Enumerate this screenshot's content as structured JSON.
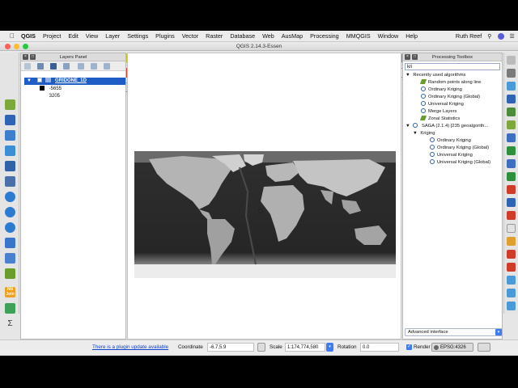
{
  "menubar": {
    "app_name": "QGIS",
    "items": [
      "Project",
      "Edit",
      "View",
      "Layer",
      "Settings",
      "Plugins",
      "Vector",
      "Raster",
      "Database",
      "Web",
      "AusMap",
      "Processing",
      "MMQGIS",
      "Window",
      "Help"
    ],
    "user": "Ruth Reef"
  },
  "window": {
    "title": "QGIS 2.14.3-Essen"
  },
  "layers_panel": {
    "title": "Layers Panel",
    "layer_name": "GRIDONE_1D",
    "legend_min": "-5655",
    "legend_max": "3205"
  },
  "processing": {
    "title": "Processing Toolbox",
    "search_value": "kri",
    "recent_group": "Recently used algorithms",
    "recent_items": [
      "Random points along line",
      "Ordinary Kriging",
      "Ordinary Kriging (Global)",
      "Universal Kriging",
      "Merge Layers",
      "Zonal Statistics"
    ],
    "saga_group": "SAGA (2.1.4) [235 geoalgorith...",
    "kriging_group": "Kriging",
    "kriging_items": [
      "Ordinary Kriging",
      "Ordinary Kriging (Global)",
      "Universal Kriging",
      "Universal Kriging (Global)"
    ],
    "interface_label": "Advanced interface"
  },
  "statusbar": {
    "plugin_update": "There is a plugin update available",
    "coordinate_label": "Coordinate",
    "coordinate_value": "-6.7,5.9",
    "scale_label": "Scale",
    "scale_value": "1:174,774,580",
    "rotation_label": "Rotation",
    "rotation_value": "0.0",
    "render_label": "Render",
    "crs": "EPSG:4326"
  }
}
